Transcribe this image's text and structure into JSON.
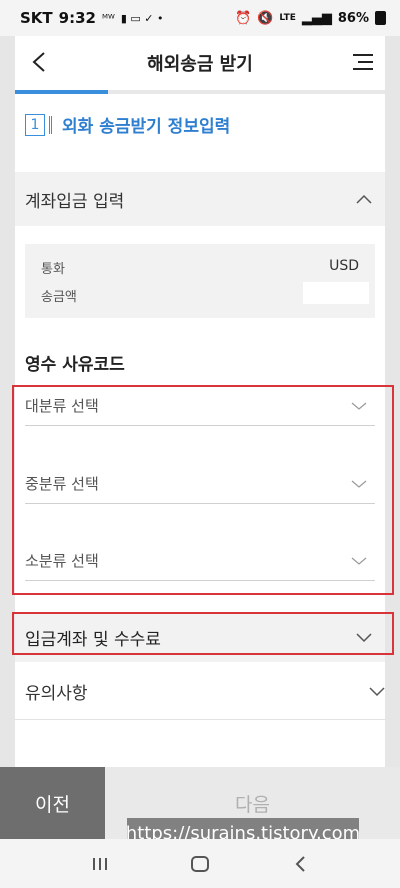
{
  "status_bar": {
    "carrier": "SKT",
    "time": "9:32",
    "indicator_text": "ᴹᵂ",
    "right_text": "LTE",
    "battery": "86%"
  },
  "header": {
    "title": "해외송금 받기"
  },
  "step": {
    "number": "1",
    "label": "외화 송금받기 정보입력"
  },
  "progress_fraction": 0.25,
  "section": {
    "label": "계좌입금 입력"
  },
  "info": {
    "currency_label": "통화",
    "currency_value": "USD",
    "amount_label": "송금액"
  },
  "receipt": {
    "title": "영수 사유코드",
    "major": "대분류 선택",
    "middle": "중분류 선택",
    "minor": "소분류 선택"
  },
  "account": {
    "label": "입금계좌 및 수수료"
  },
  "notice": {
    "label": "유의사항"
  },
  "footer": {
    "prev": "이전",
    "next": "다음"
  },
  "watermark": "https://surains.tistory.com",
  "colors": {
    "accent": "#3a8fdc",
    "highlight": "#d9343a",
    "prev_button": "#6e6e6e"
  },
  "icons": [
    "back-arrow-icon",
    "hamburger-menu-icon",
    "chevron-up-icon",
    "chevron-down-icon",
    "recent-apps-icon",
    "home-icon",
    "nav-back-icon"
  ]
}
